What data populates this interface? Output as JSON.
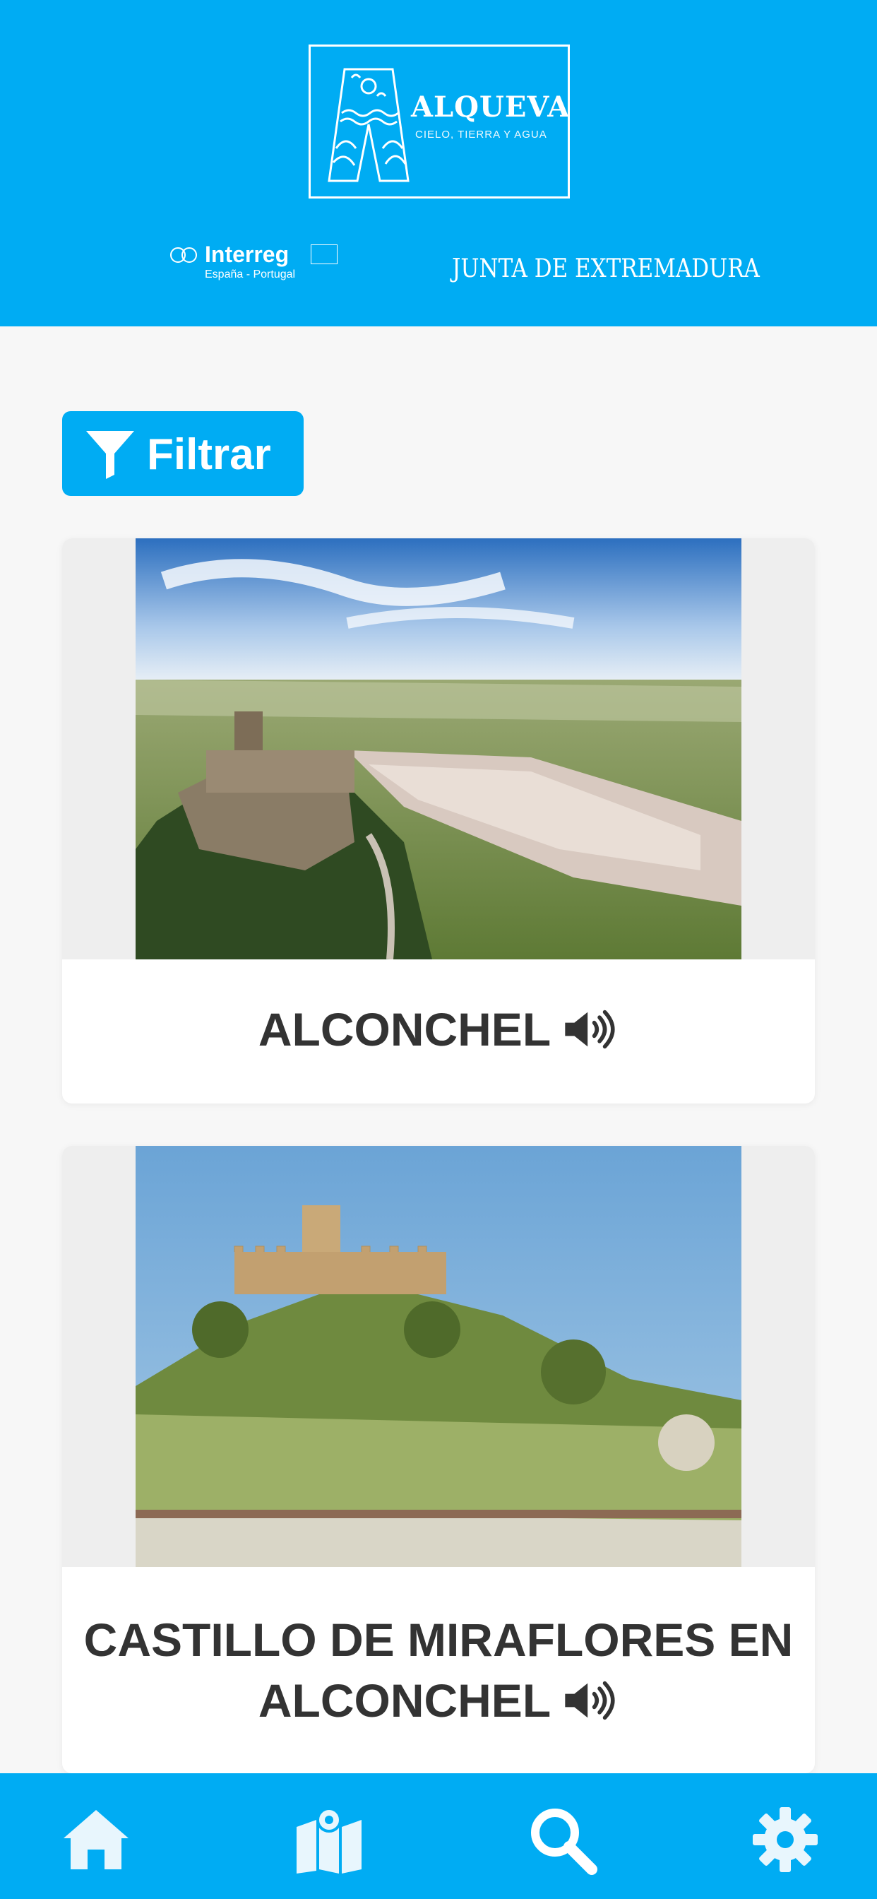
{
  "header": {
    "logo_title": "ALQUEVA",
    "logo_subtitle": "CIELO, TIERRA Y AGUA",
    "partner_interreg": "Interreg",
    "partner_interreg_sub": "España - Portugal",
    "partner_junta": "JUNTA DE EXTREMADURA",
    "color": "#00acf3"
  },
  "filter": {
    "label": "Filtrar"
  },
  "cards": [
    {
      "title": "ALCONCHEL",
      "image_icon": "aerial-castle-town-photo",
      "audio_icon": "speaker-icon"
    },
    {
      "title_line1": "CASTILLO DE MIRAFLORES EN",
      "title_line2": "ALCONCHEL",
      "image_icon": "castle-hill-photo",
      "audio_icon": "speaker-icon"
    }
  ],
  "nav": {
    "items": [
      "home-icon",
      "map-icon",
      "search-icon",
      "settings-icon"
    ],
    "active": "search-icon"
  }
}
